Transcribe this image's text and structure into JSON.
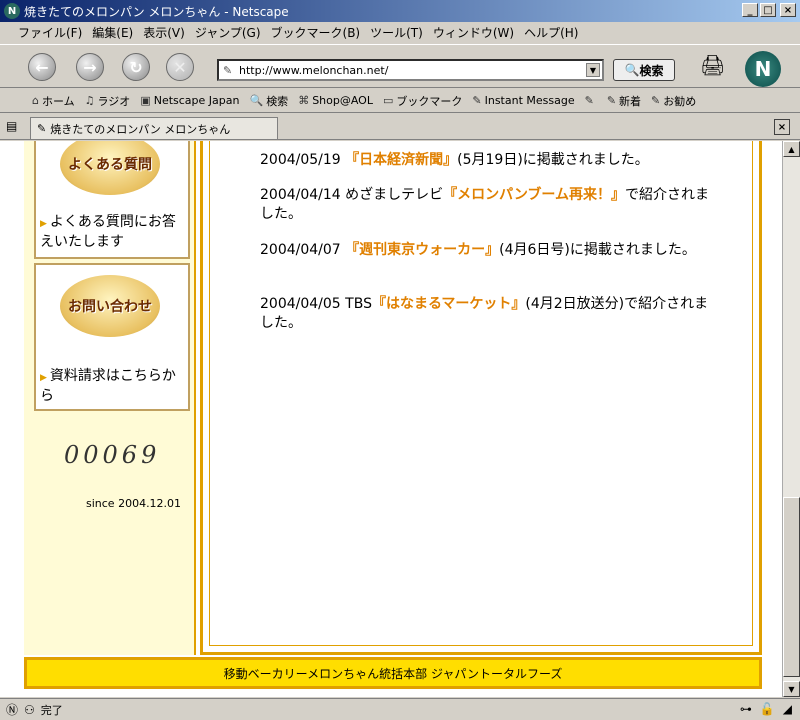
{
  "window": {
    "title": "焼きたてのメロンパン メロンちゃん - Netscape",
    "min": "_",
    "max": "□",
    "close": "×"
  },
  "menu": [
    "ファイル(F)",
    "編集(E)",
    "表示(V)",
    "ジャンプ(G)",
    "ブックマーク(B)",
    "ツール(T)",
    "ウィンドウ(W)",
    "ヘルプ(H)"
  ],
  "nav": {
    "url": "http://www.melonchan.net/",
    "search_label": "検索"
  },
  "personal": [
    "ホーム",
    "ラジオ",
    "Netscape Japan",
    "検索",
    "Shop@AOL",
    "ブックマーク",
    "Instant Message",
    "",
    "新着",
    "お勧め"
  ],
  "tab": {
    "label": "焼きたてのメロンパン メロンちゃん"
  },
  "sidebar": {
    "faq_img": "よくある質問",
    "faq_link": "よくある質問にお答えいたします",
    "contact_img": "お問い合わせ",
    "contact_link": "資料請求はこちらから",
    "counter": "00069",
    "since": "since 2004.12.01"
  },
  "news": [
    {
      "date": "2004/05/19",
      "pre": "",
      "highlight": "『日本経済新聞』",
      "post": "(5月19日)に掲載されました。"
    },
    {
      "date": "2004/04/14",
      "pre": "めざましテレビ",
      "highlight": "『メロンパンブーム再来！』",
      "post": "で紹介されました。"
    },
    {
      "date": "2004/04/07",
      "pre": "",
      "highlight": "『週刊東京ウォーカー』",
      "post": "(4月6日号)に掲載されました。"
    },
    {
      "date": "2004/04/05",
      "pre": "TBS",
      "highlight": "『はなまるマーケット』",
      "post": "(4月2日放送分)で紹介されました。"
    }
  ],
  "footer": "移動ベーカリーメロンちゃん統括本部 ジャパントータルフーズ",
  "status": "完了"
}
